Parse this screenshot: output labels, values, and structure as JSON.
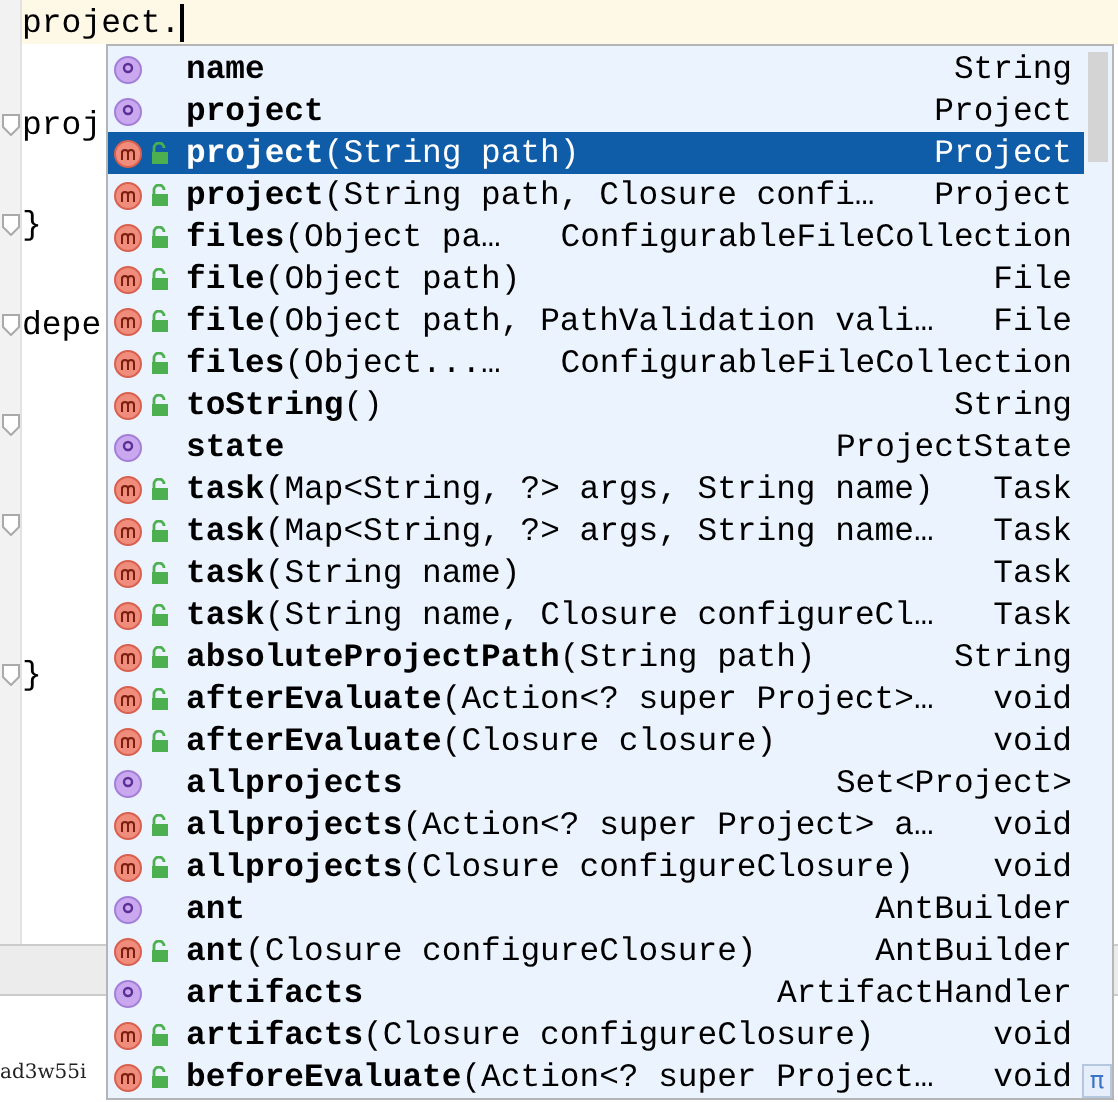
{
  "editor": {
    "lines": [
      {
        "text": "project.",
        "current": true,
        "fold": false
      },
      {
        "current": false,
        "fold": false
      },
      {
        "text": "proj",
        "current": false,
        "fold": true
      },
      {
        "current": false,
        "fold": false
      },
      {
        "text": "}",
        "current": false,
        "fold": true
      },
      {
        "current": false,
        "fold": false
      },
      {
        "text": "depe",
        "current": false,
        "fold": true
      },
      {
        "current": false,
        "fold": false
      },
      {
        "current": false,
        "fold": true
      },
      {
        "current": false,
        "fold": false
      },
      {
        "current": false,
        "fold": true
      },
      {
        "current": false,
        "fold": false
      },
      {
        "current": false,
        "fold": false
      },
      {
        "text": "}",
        "current": false,
        "fold": true
      }
    ]
  },
  "completion": {
    "items": [
      {
        "kind": "property",
        "name": "name",
        "type": "String",
        "selected": false
      },
      {
        "kind": "property",
        "name": "project",
        "type": "Project",
        "selected": false
      },
      {
        "kind": "method",
        "name": "project",
        "params": "(String path)",
        "type": "Project",
        "selected": true
      },
      {
        "kind": "method",
        "name": "project",
        "params": "(String path, Closure confi…",
        "type": "Project",
        "selected": false
      },
      {
        "kind": "method",
        "name": "files",
        "params": "(Object pa…",
        "type": "ConfigurableFileCollection",
        "selected": false
      },
      {
        "kind": "method",
        "name": "file",
        "params": "(Object path)",
        "type": "File",
        "selected": false
      },
      {
        "kind": "method",
        "name": "file",
        "params": "(Object path, PathValidation vali…",
        "type": "File",
        "selected": false
      },
      {
        "kind": "method",
        "name": "files",
        "params": "(Object...…",
        "type": "ConfigurableFileCollection",
        "selected": false
      },
      {
        "kind": "method",
        "name": "toString",
        "params": "()",
        "type": "String",
        "selected": false
      },
      {
        "kind": "property",
        "name": "state",
        "type": "ProjectState",
        "selected": false
      },
      {
        "kind": "method",
        "name": "task",
        "params": "(Map<String, ?> args, String name)",
        "type": "Task",
        "selected": false
      },
      {
        "kind": "method",
        "name": "task",
        "params": "(Map<String, ?> args, String name…",
        "type": "Task",
        "selected": false
      },
      {
        "kind": "method",
        "name": "task",
        "params": "(String name)",
        "type": "Task",
        "selected": false
      },
      {
        "kind": "method",
        "name": "task",
        "params": "(String name, Closure configureCl…",
        "type": "Task",
        "selected": false
      },
      {
        "kind": "method",
        "name": "absoluteProjectPath",
        "params": "(String path)",
        "type": "String",
        "selected": false
      },
      {
        "kind": "method",
        "name": "afterEvaluate",
        "params": "(Action<? super Project>…",
        "type": "void",
        "selected": false
      },
      {
        "kind": "method",
        "name": "afterEvaluate",
        "params": "(Closure closure)",
        "type": "void",
        "selected": false
      },
      {
        "kind": "property",
        "name": "allprojects",
        "type": "Set<Project>",
        "selected": false
      },
      {
        "kind": "method",
        "name": "allprojects",
        "params": "(Action<? super Project> a…",
        "type": "void",
        "selected": false
      },
      {
        "kind": "method",
        "name": "allprojects",
        "params": "(Closure configureClosure)",
        "type": "void",
        "selected": false
      },
      {
        "kind": "property",
        "name": "ant",
        "type": "AntBuilder",
        "selected": false
      },
      {
        "kind": "method",
        "name": "ant",
        "params": "(Closure configureClosure)",
        "type": "AntBuilder",
        "selected": false
      },
      {
        "kind": "property",
        "name": "artifacts",
        "type": "ArtifactHandler",
        "selected": false
      },
      {
        "kind": "method",
        "name": "artifacts",
        "params": "(Closure configureClosure)",
        "type": "void",
        "selected": false
      },
      {
        "kind": "method",
        "name": "beforeEvaluate",
        "params": "(Action<? super Project…",
        "type": "void",
        "selected": false
      }
    ],
    "footer_symbol": "π"
  },
  "bottom_panel": {
    "text": "ad3w55i"
  }
}
